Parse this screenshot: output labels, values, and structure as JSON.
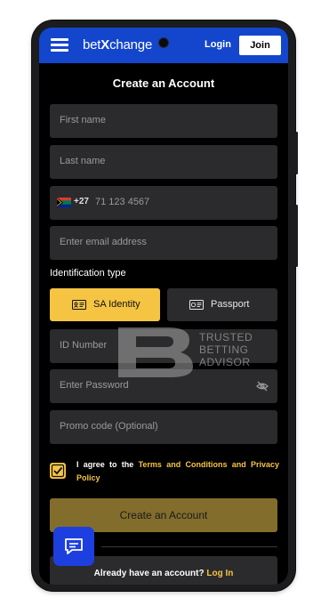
{
  "header": {
    "logo_text": "bet",
    "logo_x": "X",
    "logo_suffix": "change",
    "login_label": "Login",
    "join_label": "Join"
  },
  "form": {
    "title": "Create an Account",
    "first_name_placeholder": "First name",
    "last_name_placeholder": "Last name",
    "country_code": "+27",
    "phone_placeholder": "71 123 4567",
    "email_placeholder": "Enter email address",
    "id_type_label": "Identification type",
    "id_options": [
      "SA Identity",
      "Passport"
    ],
    "id_selected": "SA Identity",
    "id_number_placeholder": "ID Number",
    "password_placeholder": "Enter Password",
    "promo_placeholder": "Promo code (Optional)",
    "terms_checked": true,
    "terms_prefix": "I agree to the ",
    "terms_link": "Terms and Conditions and Privacy Policy",
    "create_label": "Create an Account",
    "have_account_text": "Already have an account? ",
    "login_link": "Log In"
  },
  "watermark": {
    "line1": "TRUSTED",
    "line2": "BETTING",
    "line3": "ADVISOR"
  },
  "colors": {
    "header_blue": "#1346cc",
    "accent_yellow": "#f5c443",
    "create_button": "#826d2d",
    "chat_button": "#1d3fe0"
  },
  "icons": [
    "menu-icon",
    "south-africa-flag-icon",
    "id-card-icon",
    "passport-icon",
    "eye-off-icon",
    "checkmark-icon",
    "chat-icon"
  ]
}
